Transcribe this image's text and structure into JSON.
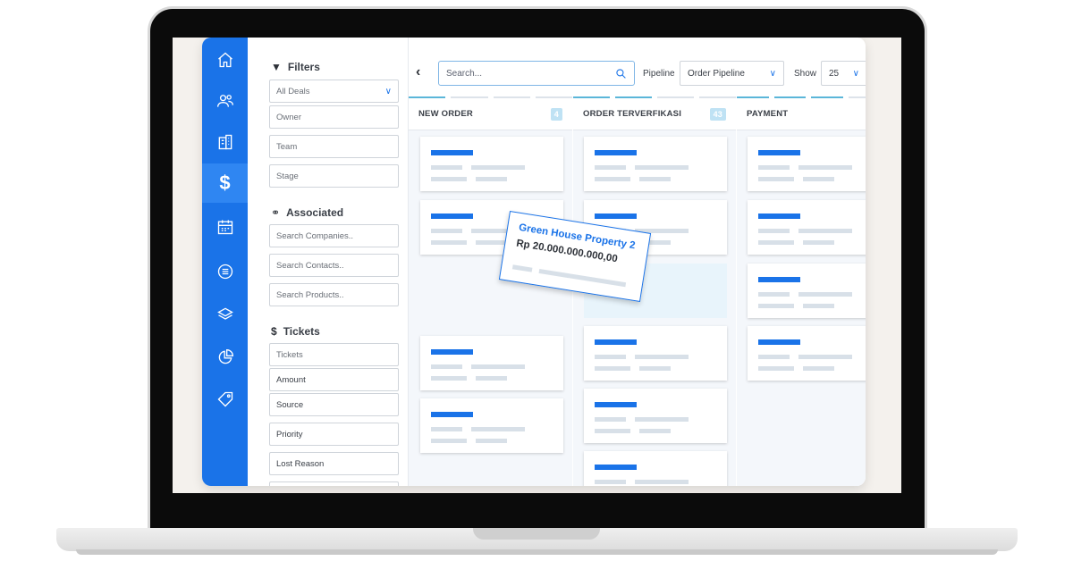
{
  "app": {
    "nav_icons": [
      "home-icon",
      "contacts-icon",
      "companies-icon",
      "deals-icon",
      "calendar-icon",
      "notes-icon",
      "layers-icon",
      "reports-icon",
      "tags-icon"
    ],
    "active_nav": "deals-icon",
    "accent_color": "#1a73e8"
  },
  "filters": {
    "title": "Filters",
    "deal_select": "All Deals",
    "owner": "Owner",
    "team": "Team",
    "stage": "Stage",
    "associated_title": "Associated",
    "search_companies": "Search Companies..",
    "search_contacts": "Search Contacts..",
    "search_products": "Search Products..",
    "tickets_title": "Tickets",
    "tickets": "Tickets",
    "amount": "Amount",
    "source": "Source",
    "priority": "Priority",
    "lost_reason": "Lost Reason"
  },
  "toolbar": {
    "search_placeholder": "Search...",
    "pipeline_label": "Pipeline",
    "pipeline_value": "Order Pipeline",
    "show_label": "Show",
    "show_value": "25"
  },
  "columns": [
    {
      "title": "NEW ORDER",
      "count": "4"
    },
    {
      "title": "ORDER TERVERFIKASI",
      "count": "43"
    },
    {
      "title": "PAYMENT",
      "count": ""
    }
  ],
  "dragged_card": {
    "name": "Green House Property 2",
    "amount": "Rp 20.000.000.000,00"
  }
}
